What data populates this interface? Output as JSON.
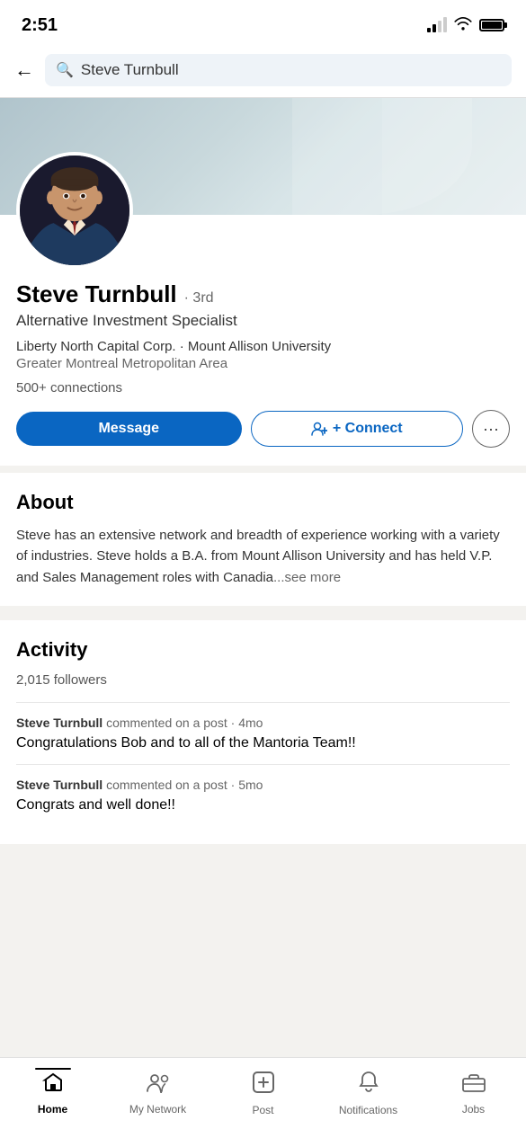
{
  "statusBar": {
    "time": "2:51",
    "signalBars": [
      true,
      true,
      false,
      false
    ],
    "hasWifi": true,
    "hasBattery": true
  },
  "searchBar": {
    "backLabel": "←",
    "searchValue": "Steve Turnbull",
    "searchPlaceholder": "Search"
  },
  "profile": {
    "name": "Steve Turnbull",
    "degree": "· 3rd",
    "title": "Alternative Investment Specialist",
    "company": "Liberty North Capital Corp.",
    "university": "Mount Allison University",
    "location": "Greater Montreal Metropolitan Area",
    "connections": "500+ connections",
    "buttons": {
      "message": "Message",
      "connect": "+ Connect",
      "more": "···"
    }
  },
  "about": {
    "sectionTitle": "About",
    "text": "Steve has an extensive network and breadth of experience working with a variety of industries. Steve holds a B.A. from Mount Allison University and has held V.P. and Sales Management roles with Canadia",
    "seeMore": "...see more"
  },
  "activity": {
    "sectionTitle": "Activity",
    "followers": "2,015 followers",
    "items": [
      {
        "author": "Steve Turnbull",
        "action": "commented on a post",
        "time": "4mo",
        "content": "Congratulations Bob and to all of the Mantoria Team!!"
      },
      {
        "author": "Steve Turnbull",
        "action": "commented on a post",
        "time": "5mo",
        "content": "Congrats and well done!!"
      }
    ]
  },
  "bottomNav": {
    "items": [
      {
        "id": "home",
        "label": "Home",
        "icon": "🏠",
        "active": true
      },
      {
        "id": "my-network",
        "label": "My Network",
        "icon": "👥",
        "active": false
      },
      {
        "id": "post",
        "label": "Post",
        "icon": "➕",
        "active": false
      },
      {
        "id": "notifications",
        "label": "Notifications",
        "icon": "🔔",
        "active": false
      },
      {
        "id": "jobs",
        "label": "Jobs",
        "icon": "💼",
        "active": false
      }
    ]
  }
}
